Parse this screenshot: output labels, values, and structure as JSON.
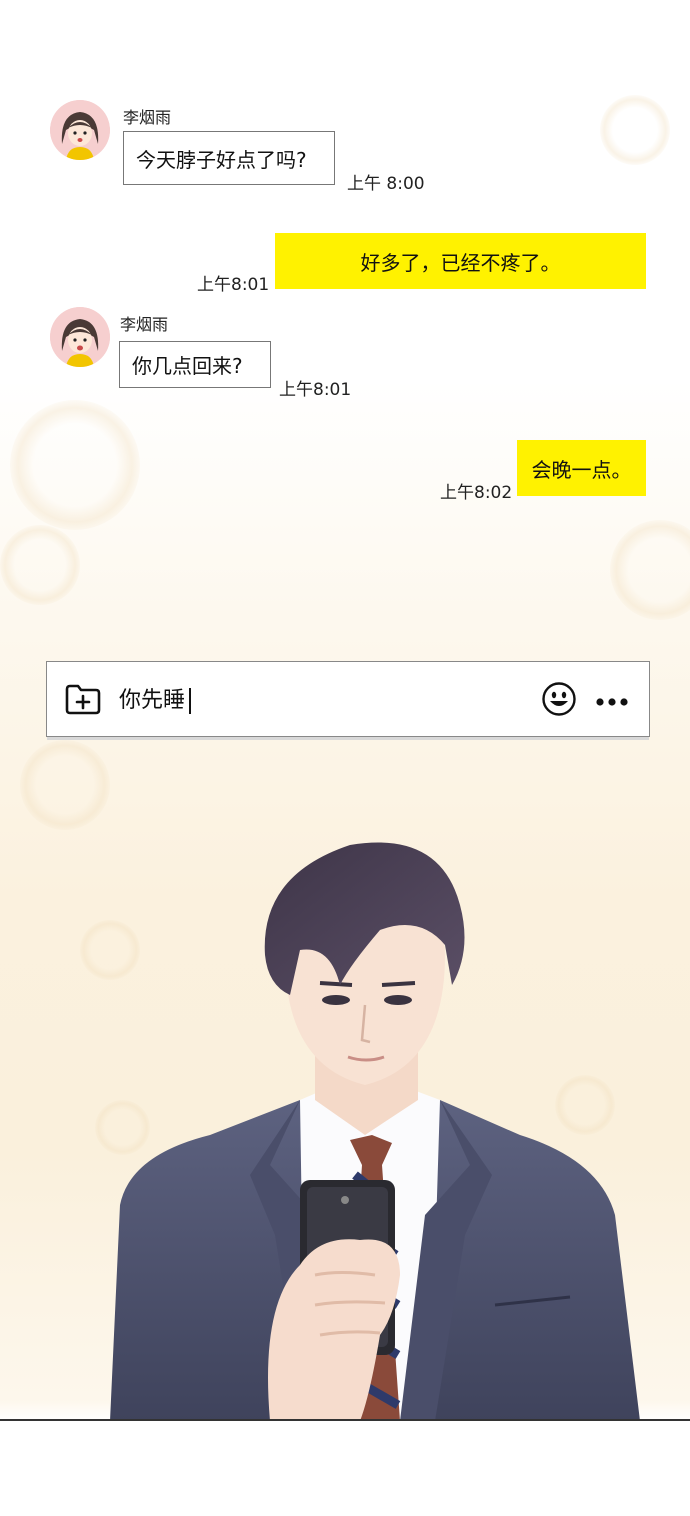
{
  "messages": [
    {
      "side": "left",
      "sender": "李烟雨",
      "text": "今天脖子好点了吗?",
      "time": "上午 8:00"
    },
    {
      "side": "right",
      "text": "好多了，已经不疼了。",
      "time": "上午8:01"
    },
    {
      "side": "left",
      "sender": "李烟雨",
      "text": "你几点回来?",
      "time": "上午8:01"
    },
    {
      "side": "right",
      "text": "会晚一点。",
      "time": "上午8:02"
    }
  ],
  "input": {
    "value": "你先睡",
    "attach_icon": "folder-plus-icon",
    "emoji_icon": "smiley-icon",
    "more_icon": "ellipsis-icon"
  },
  "colors": {
    "outgoing_bubble": "#fff200",
    "incoming_border": "#777777",
    "avatar_bg": "#f6cfcf"
  }
}
